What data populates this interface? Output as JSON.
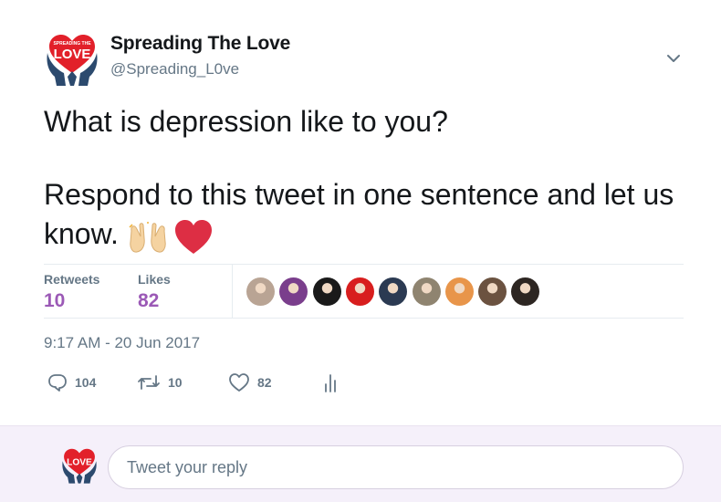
{
  "author": {
    "name": "Spreading The Love",
    "handle": "@Spreading_L0ve",
    "logo_text_top": "SPREADING THE",
    "logo_text_big": "LOVE"
  },
  "tweet": {
    "line1": "What is depression like to you?",
    "line2": "Respond to this tweet in one sentence and let us know.",
    "emojis": [
      "raising-hands-icon",
      "red-heart-icon"
    ]
  },
  "stats": {
    "retweets_label": "Retweets",
    "retweets_value": "10",
    "likes_label": "Likes",
    "likes_value": "82",
    "value_color": "#9b59b6",
    "likers": [
      {
        "name": "liker-avatar-1",
        "color": "#b9a494"
      },
      {
        "name": "liker-avatar-2",
        "color": "#7a3e8c"
      },
      {
        "name": "liker-avatar-3",
        "color": "#1a1a1a"
      },
      {
        "name": "liker-avatar-4",
        "color": "#d81e1e"
      },
      {
        "name": "liker-avatar-5",
        "color": "#2b3a52"
      },
      {
        "name": "liker-avatar-6",
        "color": "#8f8470"
      },
      {
        "name": "liker-avatar-7",
        "color": "#e8954a"
      },
      {
        "name": "liker-avatar-8",
        "color": "#6b5240"
      },
      {
        "name": "liker-avatar-9",
        "color": "#2d2622"
      }
    ]
  },
  "timestamp": "9:17 AM - 20 Jun 2017",
  "actions": {
    "replies": "104",
    "retweets": "10",
    "likes": "82"
  },
  "reply": {
    "placeholder": "Tweet your reply"
  }
}
